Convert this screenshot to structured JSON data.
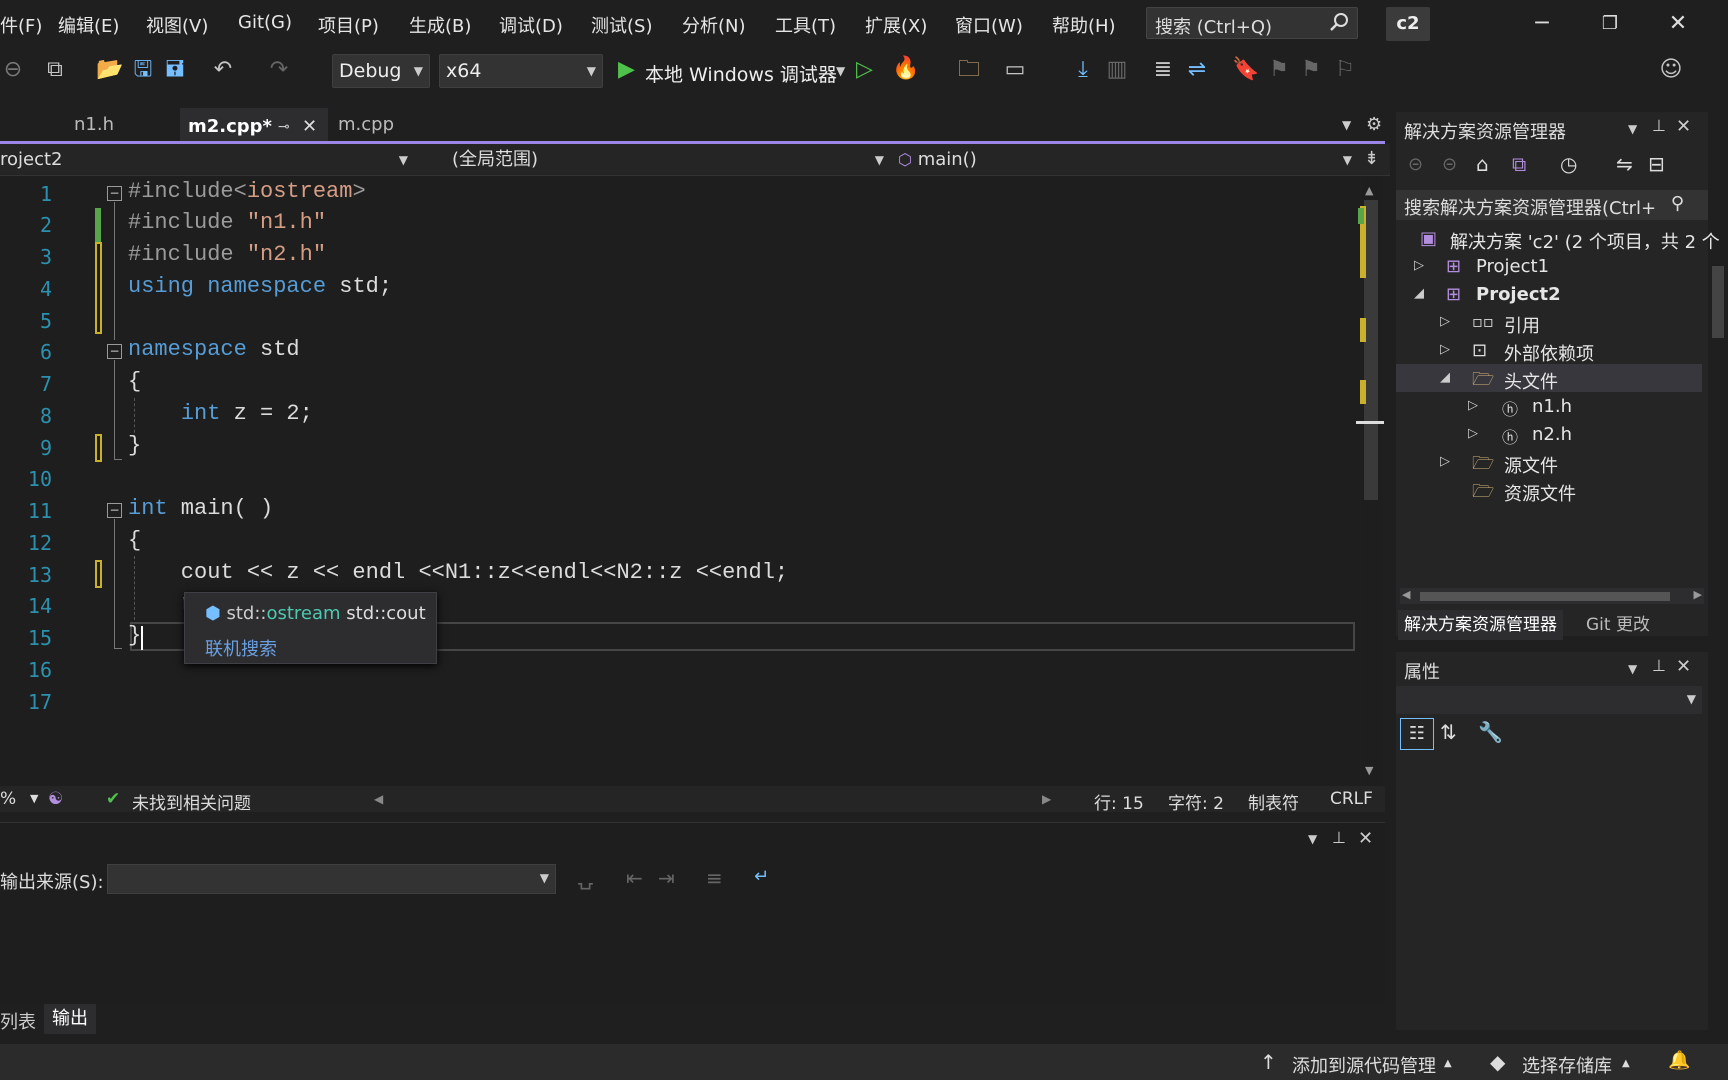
{
  "menubar": {
    "items": [
      "件(F)",
      "编辑(E)",
      "视图(V)",
      "Git(G)",
      "项目(P)",
      "生成(B)",
      "调试(D)",
      "测试(S)",
      "分析(N)",
      "工具(T)",
      "扩展(X)",
      "窗口(W)",
      "帮助(H)"
    ],
    "search_placeholder": "搜索 (Ctrl+Q)",
    "solution_name": "c2"
  },
  "toolbar": {
    "config": "Debug",
    "platform": "x64",
    "debugger_label": "本地 Windows 调试器"
  },
  "tabs": [
    {
      "label": "n1.h",
      "active": false
    },
    {
      "label": "m2.cpp*",
      "active": true
    },
    {
      "label": "m.cpp",
      "active": false
    }
  ],
  "navbar": {
    "project": "roject2",
    "scope": "(全局范围)",
    "member": "main()"
  },
  "code": {
    "line_numbers": [
      "1",
      "2",
      "3",
      "4",
      "5",
      "6",
      "7",
      "8",
      "9",
      "10",
      "11",
      "12",
      "13",
      "14",
      "15",
      "16",
      "17"
    ]
  },
  "tooltip": {
    "prefix": "std::",
    "type": "ostream",
    "rest": " std::cout",
    "link": "联机搜索"
  },
  "editor_status": {
    "zoom": "%",
    "issues": "未找到相关问题",
    "line": "行: 15",
    "col": "字符: 2",
    "tabs": "制表符",
    "eol": "CRLF"
  },
  "output": {
    "source_label": "输出来源(S):"
  },
  "bottom_tabs": [
    "列表",
    "输出"
  ],
  "statusbar": {
    "add_source": "添加到源代码管理",
    "select_repo": "选择存储库"
  },
  "solution_explorer": {
    "title": "解决方案资源管理器",
    "search": "搜索解决方案资源管理器(Ctrl+",
    "root": "解决方案 'c2' (2 个项目，共 2 个",
    "items": [
      {
        "label": "Project1",
        "bold": false
      },
      {
        "label": "Project2",
        "bold": true
      },
      {
        "label": "引用",
        "bold": false
      },
      {
        "label": "外部依赖项",
        "bold": false
      },
      {
        "label": "头文件",
        "bold": false
      },
      {
        "label": "n1.h",
        "bold": false
      },
      {
        "label": "n2.h",
        "bold": false
      },
      {
        "label": "源文件",
        "bold": false
      },
      {
        "label": "资源文件",
        "bold": false
      }
    ],
    "tab_explorer": "解决方案资源管理器",
    "tab_git": "Git 更改"
  },
  "properties": {
    "title": "属性"
  },
  "colors": {
    "accent": "#9a86e6",
    "keyword": "#569cd6",
    "string": "#d69d85",
    "line_number": "#2b91af",
    "change_marker": "#c9b02d",
    "saved_marker": "#57a64a"
  }
}
